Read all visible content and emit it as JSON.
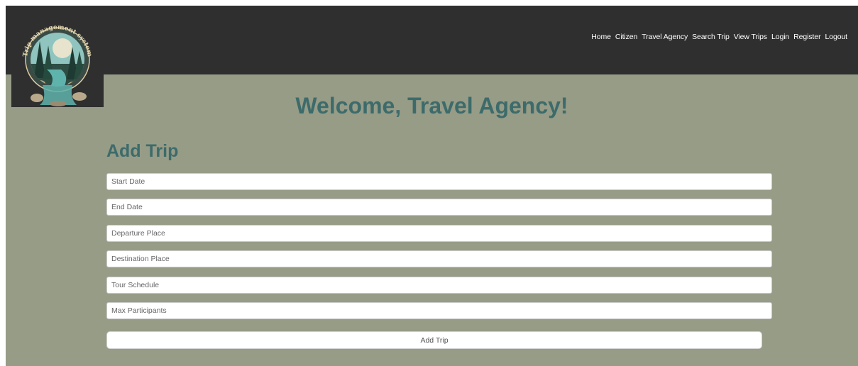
{
  "logo": {
    "text": "Trip management system",
    "icon": "forest-river-logo"
  },
  "nav": {
    "items": [
      {
        "label": "Home"
      },
      {
        "label": "Citizen"
      },
      {
        "label": "Travel Agency"
      },
      {
        "label": "Search Trip"
      },
      {
        "label": "View Trips"
      },
      {
        "label": "Login"
      },
      {
        "label": "Register"
      },
      {
        "label": "Logout"
      }
    ]
  },
  "main": {
    "welcome": "Welcome, Travel Agency!",
    "form_title": "Add Trip",
    "fields": [
      {
        "placeholder": "Start Date",
        "value": ""
      },
      {
        "placeholder": "End Date",
        "value": ""
      },
      {
        "placeholder": "Departure Place",
        "value": ""
      },
      {
        "placeholder": "Destination Place",
        "value": ""
      },
      {
        "placeholder": "Tour Schedule",
        "value": ""
      },
      {
        "placeholder": "Max Participants",
        "value": ""
      }
    ],
    "submit_label": "Add Trip"
  },
  "colors": {
    "header_bg": "#2f2f2f",
    "page_bg": "#979c87",
    "heading": "#3d6b6b",
    "nav_text": "#ffffff"
  }
}
